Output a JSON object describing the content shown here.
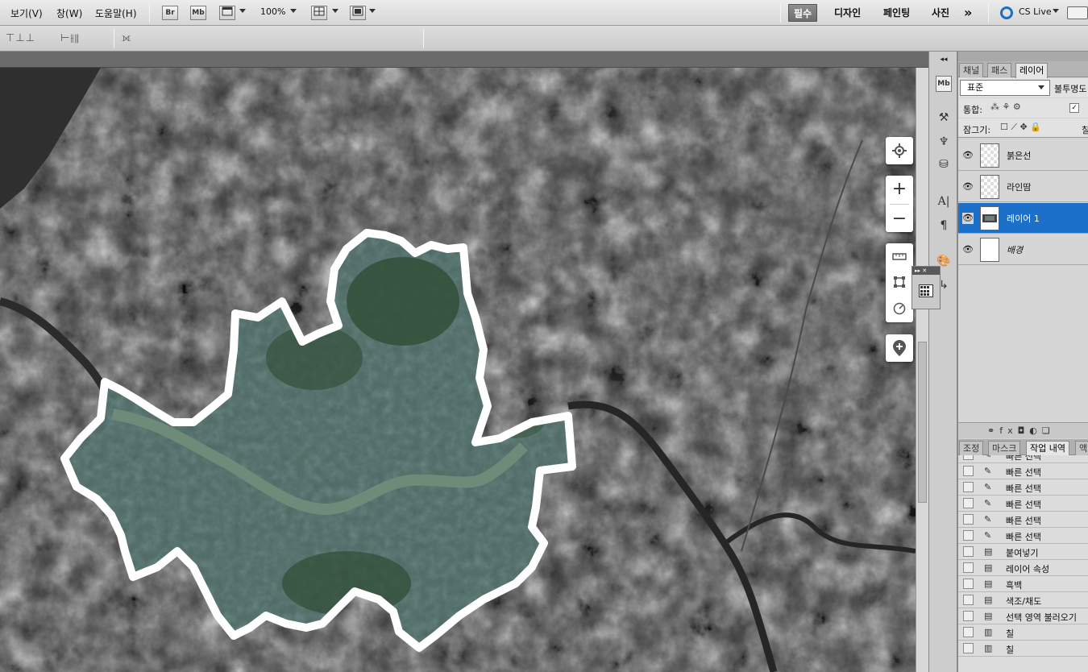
{
  "menubar": {
    "menus": [
      "보기(V)",
      "창(W)",
      "도움말(H)"
    ],
    "launch_buttons": [
      "Br",
      "Mb"
    ],
    "zoom": "100%",
    "workspaces": [
      "필수",
      "디자인",
      "페인팅",
      "사진"
    ],
    "active_workspace": "필수",
    "overflow": "»",
    "cs_live": "CS Live"
  },
  "panels": {
    "top_tabs": [
      "채널",
      "패스",
      "레이어"
    ],
    "active_top_tab": "레이어",
    "blend_mode": "표준",
    "opacity_label": "불투명도",
    "unify_label": "통합:",
    "lock_label": "잠그기:",
    "lock_fill_label": "칠",
    "layers": [
      {
        "name": "붉은선",
        "selected": false,
        "thumb": "transparent"
      },
      {
        "name": "라인땀",
        "selected": false,
        "thumb": "transparent"
      },
      {
        "name": "레이어 1",
        "selected": true,
        "thumb": "image"
      },
      {
        "name": "배경",
        "selected": false,
        "thumb": "white"
      }
    ],
    "bottom_tabs": [
      "조정",
      "마스크",
      "작업 내역",
      "액"
    ],
    "active_bottom_tab": "작업 내역",
    "history": [
      {
        "label": "빠른 선택",
        "icon": "quick-select"
      },
      {
        "label": "빠른 선택",
        "icon": "quick-select"
      },
      {
        "label": "빠른 선택",
        "icon": "quick-select"
      },
      {
        "label": "빠른 선택",
        "icon": "quick-select"
      },
      {
        "label": "빠른 선택",
        "icon": "quick-select"
      },
      {
        "label": "빠른 선택",
        "icon": "quick-select"
      },
      {
        "label": "붙여넣기",
        "icon": "document"
      },
      {
        "label": "레이어 속성",
        "icon": "document"
      },
      {
        "label": "흑백",
        "icon": "document"
      },
      {
        "label": "색조/채도",
        "icon": "document"
      },
      {
        "label": "선택 영역 불러오기",
        "icon": "document"
      },
      {
        "label": "칠",
        "icon": "fill"
      },
      {
        "label": "칠",
        "icon": "fill"
      }
    ]
  },
  "map_controls": {
    "zoom_in": "+",
    "zoom_out": "−"
  },
  "colors": {
    "selection": "#1c70c9",
    "outline": "#ffffff",
    "seoul_tint": "#5e7a74",
    "river": "#6e8a78"
  }
}
